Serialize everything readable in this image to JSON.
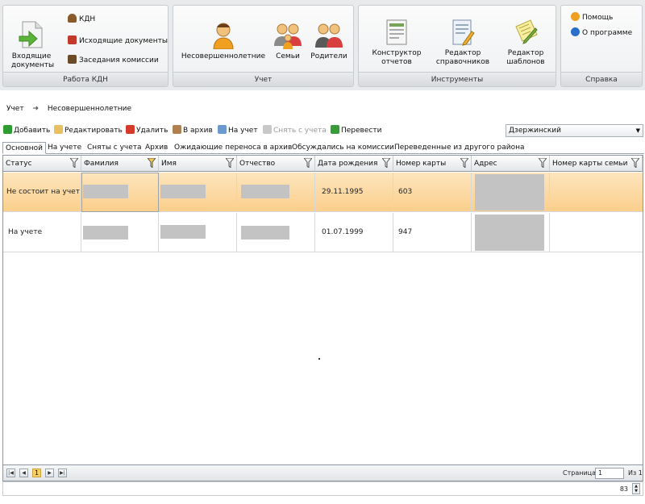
{
  "ribbon": {
    "groups": [
      {
        "title": "Работа КДН"
      },
      {
        "title": "Учет"
      },
      {
        "title": "Инструменты"
      },
      {
        "title": "Справка"
      }
    ],
    "kdn": {
      "incoming": "Входящие документы",
      "kdn_label": "КДН",
      "outgoing": "Исходящие документы",
      "meetings": "Заседания комиссии"
    },
    "uchet": {
      "minors": "Несовершеннолетние",
      "families": "Семьи",
      "parents": "Родители"
    },
    "tools": {
      "report_builder": "Конструктор отчетов",
      "dict_editor": "Редактор справочников",
      "template_editor": "Редактор шаблонов"
    },
    "help": {
      "help": "Помощь",
      "about": "О программе"
    }
  },
  "breadcrumb": {
    "root": "Учет",
    "current": "Несовершеннолетние"
  },
  "toolbar": {
    "add": "Добавить",
    "edit": "Редактировать",
    "delete": "Удалить",
    "archive": "В архив",
    "register": "На учет",
    "deregister": "Снять с учета",
    "transfer": "Перевести",
    "district": "Дзержинский"
  },
  "tabs": [
    "Основной",
    "На учете",
    "Сняты с учета",
    "Архив",
    "Ожидающие переноса в архив",
    "Обсуждались на комиссии",
    "Переведенные из другого района"
  ],
  "columns": [
    "Статус",
    "Фамилия",
    "Имя",
    "Отчество",
    "Дата рождения",
    "Номер карты",
    "Адрес",
    "Номер карты семьи"
  ],
  "rows": [
    {
      "status": "Не состоит на учет",
      "birth_date": "29.11.1995",
      "card": "603",
      "selected": true
    },
    {
      "status": "На учете",
      "birth_date": "01.07.1999",
      "card": "947",
      "selected": false
    }
  ],
  "pager": {
    "current_page": "1",
    "page_label": "Страница",
    "page_value": "1",
    "of_label": "Из 1"
  },
  "status": {
    "count": "83"
  },
  "colors": {
    "selected_row": "#fbd79a",
    "add_icon": "#2e9c2e",
    "delete_icon": "#d63a2a",
    "transfer_icon": "#3b9a3b"
  }
}
